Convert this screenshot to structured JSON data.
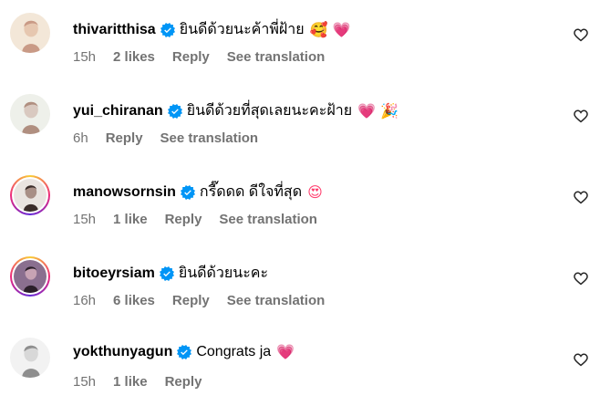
{
  "comments": [
    {
      "username": "thivaritthisa",
      "text": "ยินดีด้วยนะค้าพี่ฝ้าย",
      "emojis": "🥰 💗",
      "time": "15h",
      "likes": "2 likes",
      "reply": "Reply",
      "translation": "See translation",
      "avatar_style": "plain",
      "avatar_colors": [
        "#f3e7d8",
        "#e6c7b0",
        "#c99a86"
      ]
    },
    {
      "username": "yui_chiranan",
      "text": "ยินดีด้วยที่สุดเลยนะคะฝ้าย",
      "emojis": "💗 🎉",
      "time": "6h",
      "likes": "",
      "reply": "Reply",
      "translation": "See translation",
      "avatar_style": "plain",
      "avatar_colors": [
        "#eef0ea",
        "#d9c9c0",
        "#b08f80"
      ]
    },
    {
      "username": "manowsornsin",
      "text": "กรี๊ดดด ดีใจที่สุด",
      "emojis": "😍",
      "time": "15h",
      "likes": "1 like",
      "reply": "Reply",
      "translation": "See translation",
      "avatar_style": "ring",
      "avatar_colors": [
        "#e9e4e0",
        "#a88f86",
        "#3a2d2a"
      ]
    },
    {
      "username": "bitoeyrsiam",
      "text": "ยินดีด้วยนะคะ",
      "emojis": "",
      "time": "16h",
      "likes": "6 likes",
      "reply": "Reply",
      "translation": "See translation",
      "avatar_style": "ring",
      "avatar_colors": [
        "#8a6f8f",
        "#c7a3b4",
        "#2b1f2a"
      ]
    },
    {
      "username": "yokthunyagun",
      "text": "Congrats ja",
      "emojis": "💗",
      "time": "15h",
      "likes": "1 like",
      "reply": "Reply",
      "translation": "",
      "avatar_style": "plain",
      "avatar_colors": [
        "#f2f2f2",
        "#d8d8d8",
        "#8e8e8e"
      ]
    }
  ],
  "colors": {
    "verified": "#0095f6",
    "muted": "#737373",
    "heart_emoji": "#ff3b6b"
  },
  "icons": {
    "verified": "verified-badge-icon",
    "like": "heart-outline-icon"
  }
}
